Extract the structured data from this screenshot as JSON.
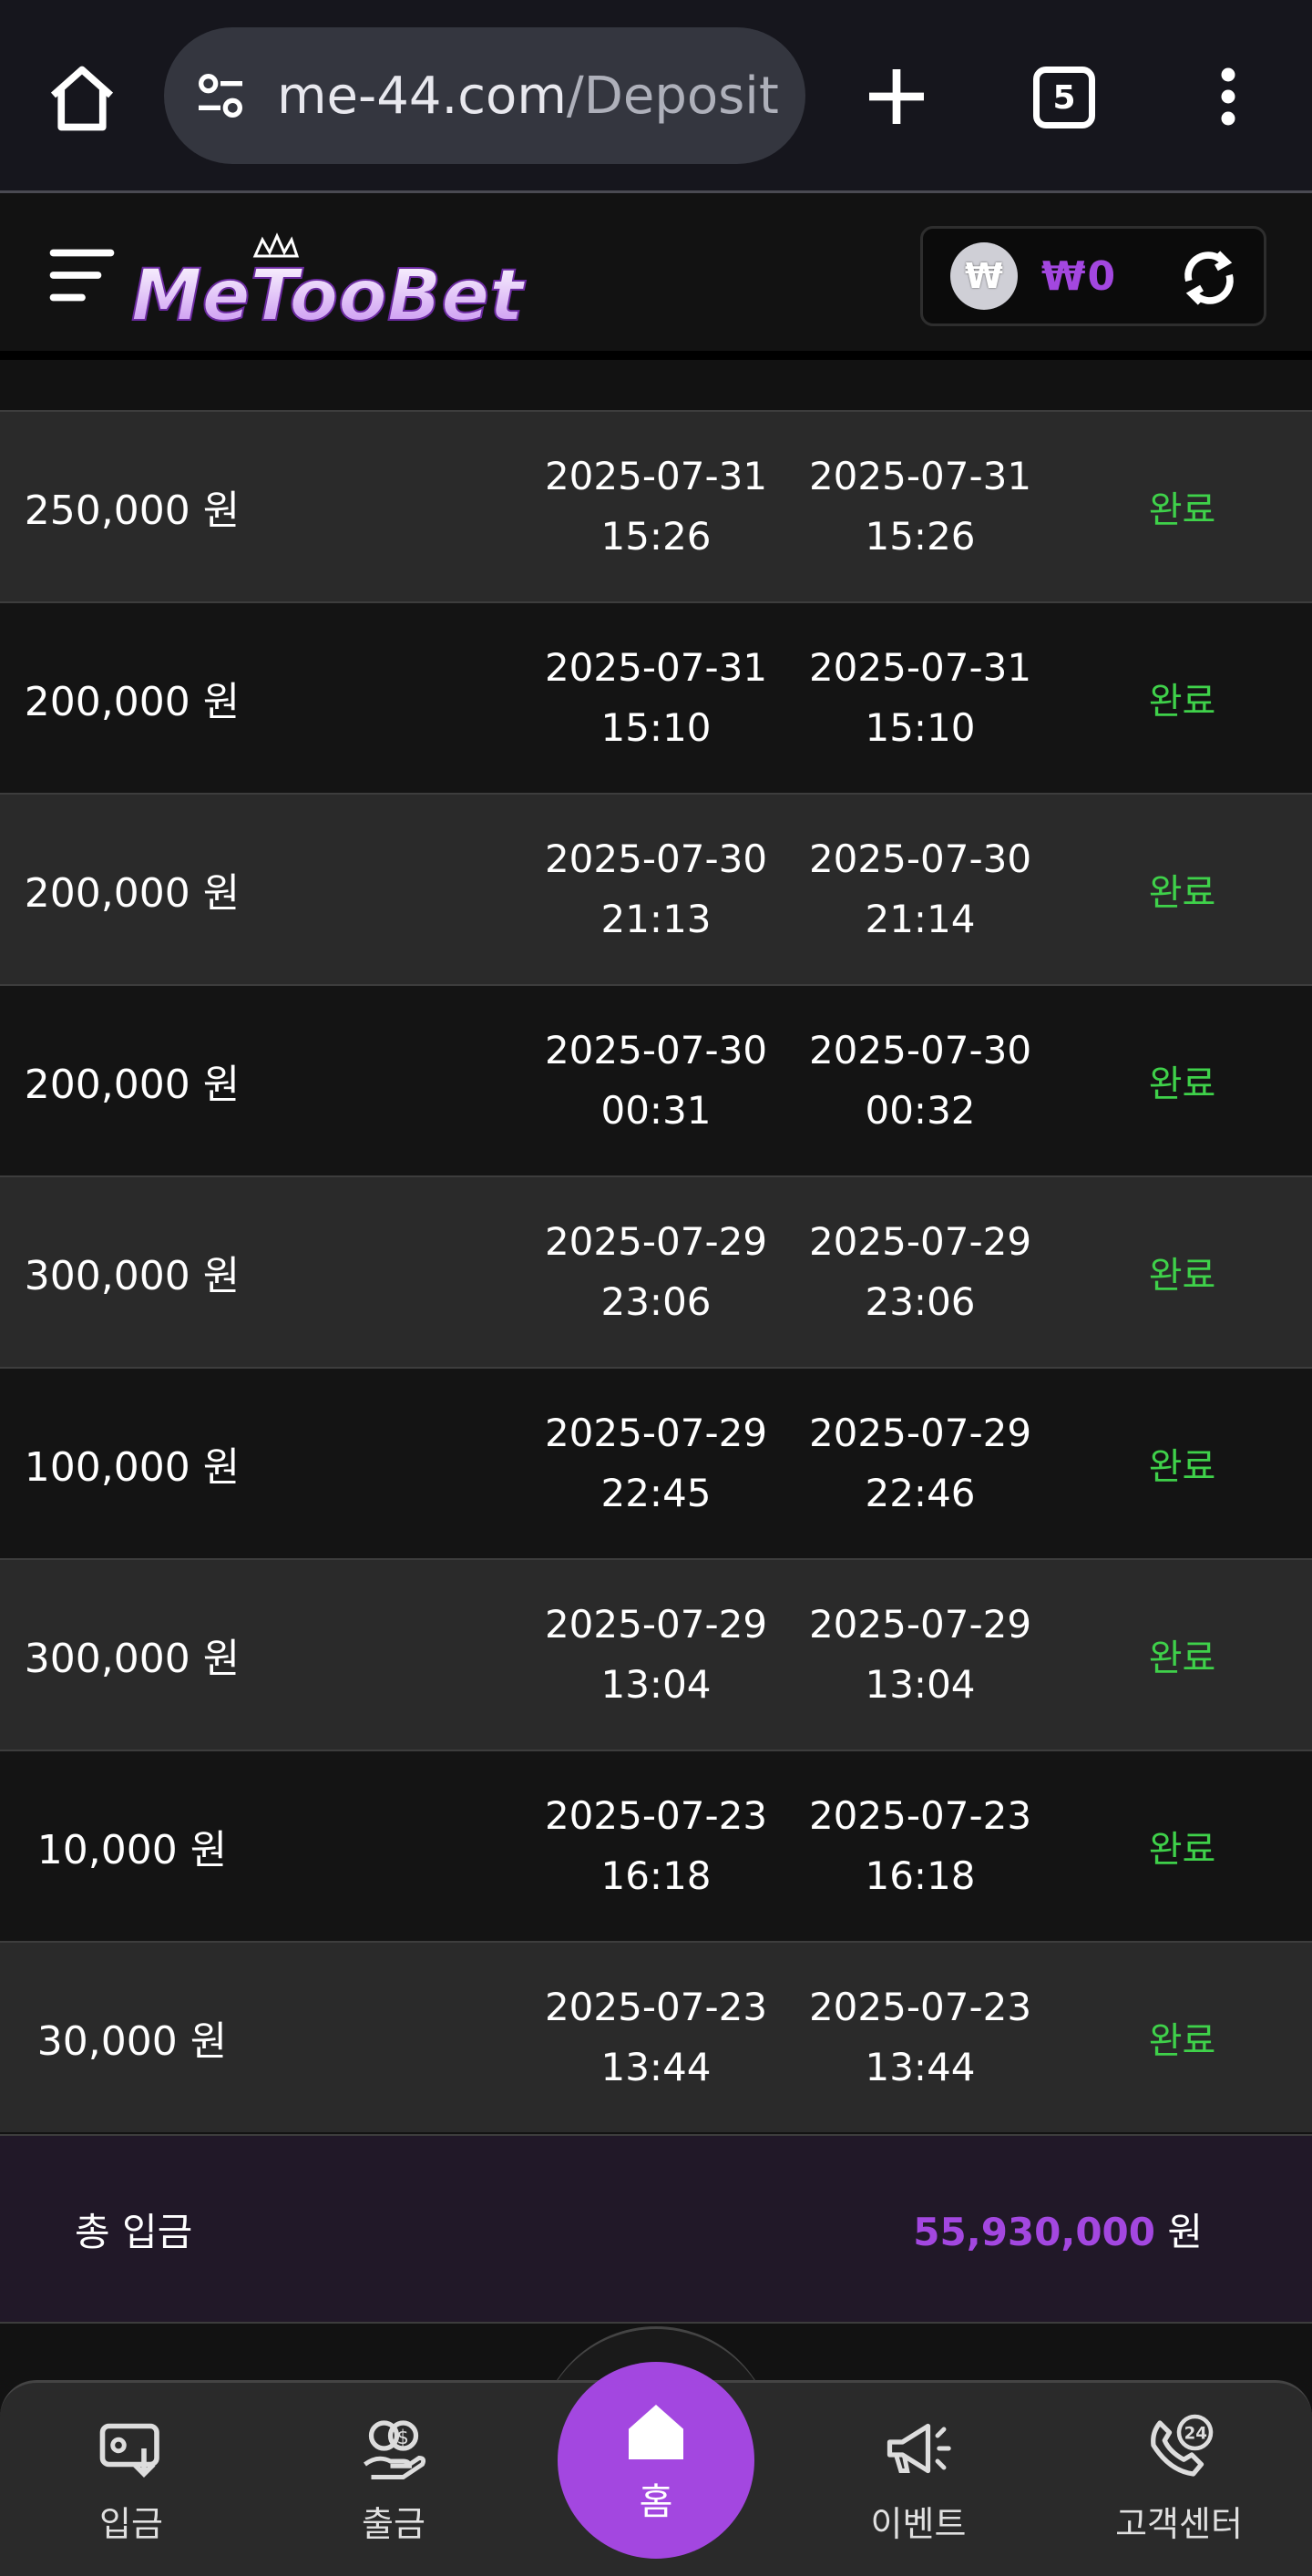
{
  "browser": {
    "url_host": "me-44.com",
    "url_path": "/Deposit",
    "tab_count": "5"
  },
  "site": {
    "logo_text": "MeTooBet",
    "wallet_currency_symbol": "₩",
    "wallet_amount": "₩0"
  },
  "deposits": [
    {
      "amount": "250,000 원",
      "requested_date": "2025-07-31",
      "requested_time": "15:26",
      "processed_date": "2025-07-31",
      "processed_time": "15:26",
      "status": "완료"
    },
    {
      "amount": "200,000 원",
      "requested_date": "2025-07-31",
      "requested_time": "15:10",
      "processed_date": "2025-07-31",
      "processed_time": "15:10",
      "status": "완료"
    },
    {
      "amount": "200,000 원",
      "requested_date": "2025-07-30",
      "requested_time": "21:13",
      "processed_date": "2025-07-30",
      "processed_time": "21:14",
      "status": "완료"
    },
    {
      "amount": "200,000 원",
      "requested_date": "2025-07-30",
      "requested_time": "00:31",
      "processed_date": "2025-07-30",
      "processed_time": "00:32",
      "status": "완료"
    },
    {
      "amount": "300,000 원",
      "requested_date": "2025-07-29",
      "requested_time": "23:06",
      "processed_date": "2025-07-29",
      "processed_time": "23:06",
      "status": "완료"
    },
    {
      "amount": "100,000 원",
      "requested_date": "2025-07-29",
      "requested_time": "22:45",
      "processed_date": "2025-07-29",
      "processed_time": "22:46",
      "status": "완료"
    },
    {
      "amount": "300,000 원",
      "requested_date": "2025-07-29",
      "requested_time": "13:04",
      "processed_date": "2025-07-29",
      "processed_time": "13:04",
      "status": "완료"
    },
    {
      "amount": "10,000 원",
      "requested_date": "2025-07-23",
      "requested_time": "16:18",
      "processed_date": "2025-07-23",
      "processed_time": "16:18",
      "status": "완료"
    },
    {
      "amount": "30,000 원",
      "requested_date": "2025-07-23",
      "requested_time": "13:44",
      "processed_date": "2025-07-23",
      "processed_time": "13:44",
      "status": "완료"
    }
  ],
  "total": {
    "label": "총 입금",
    "value": "55,930,000",
    "unit": "원"
  },
  "bottom_nav": {
    "deposit": "입금",
    "withdraw": "출금",
    "home": "홈",
    "event": "이벤트",
    "support": "고객센터"
  },
  "colors": {
    "accent": "#a347e0",
    "status_complete": "#3fd14a",
    "row_odd": "#2a2a2a",
    "row_even": "#141414"
  },
  "icons": [
    "home-icon",
    "site-settings-icon",
    "new-tab-icon",
    "tab-switcher-icon",
    "more-menu-icon",
    "hamburger-icon",
    "won-coin-icon",
    "refresh-icon",
    "wallet-deposit-icon",
    "coins-hand-icon",
    "megaphone-icon",
    "phone-24-icon"
  ]
}
